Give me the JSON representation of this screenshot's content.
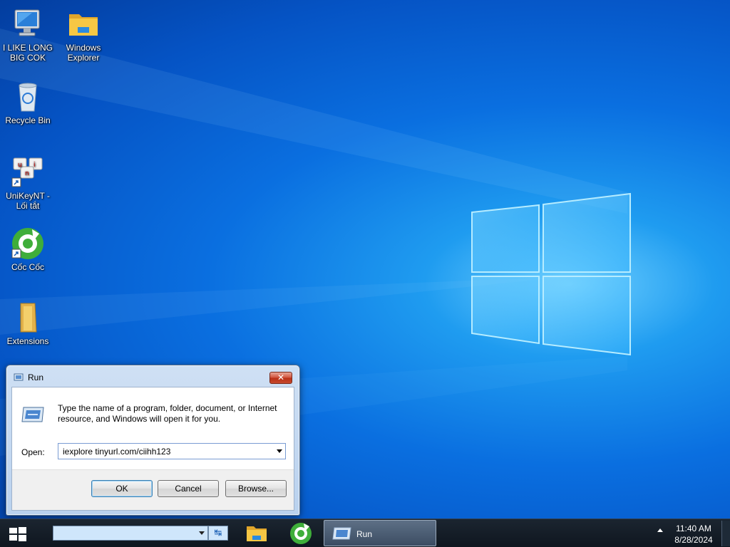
{
  "desktop": {
    "icons": [
      {
        "label": "I LIKE LONG\nBIG COK",
        "icon": "computer-icon"
      },
      {
        "label": "Windows\nExplorer",
        "icon": "folder-icon"
      },
      {
        "label": "Recycle Bin",
        "icon": "recycle-bin-icon"
      },
      {
        "label": "UniKeyNT -\nLối tắt",
        "icon": "unikey-icon"
      },
      {
        "label": "Cốc Cốc",
        "icon": "coccoc-icon"
      },
      {
        "label": "Extensions",
        "icon": "folder-icon"
      }
    ]
  },
  "run_dialog": {
    "title": "Run",
    "close_label": "✕",
    "description": "Type the name of a program, folder, document, or Internet resource, and Windows will open it for you.",
    "open_label": "Open:",
    "open_value": "iexplore tinyurl.com/ciihh123",
    "ok_label": "OK",
    "cancel_label": "Cancel",
    "browse_label": "Browse..."
  },
  "taskbar": {
    "search_value": "",
    "go_icon": "↹",
    "running_app_label": "Run",
    "time": "11:40 AM",
    "date": "8/28/2024"
  }
}
